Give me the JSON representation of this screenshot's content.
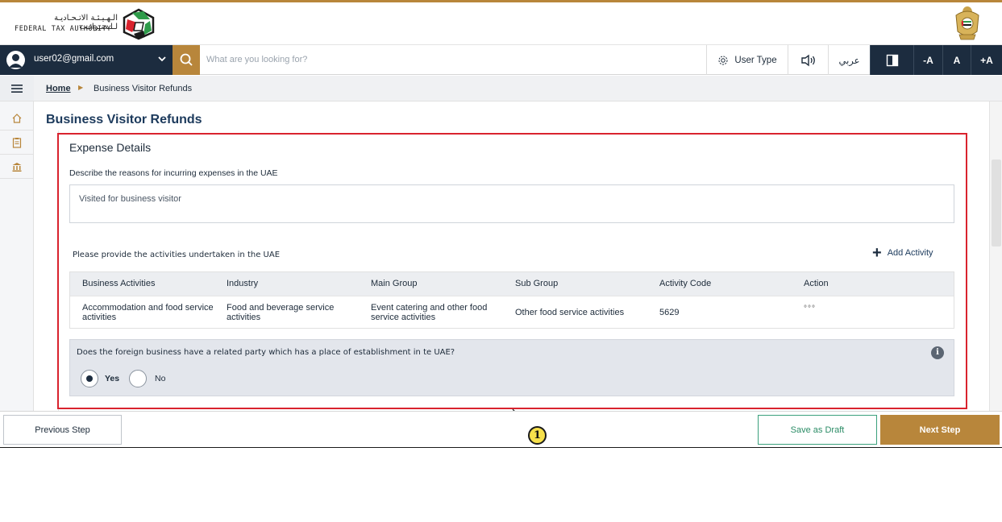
{
  "header": {
    "logo_arabic": "الـهـيـئـة الاتـحـاديـة لـلـضـرائـب",
    "logo_english": "FEDERAL TAX AUTHORITY",
    "logo_icon": "fta-logo-icon",
    "emblem_icon": "uae-emblem-icon"
  },
  "toolbar": {
    "user_email": "user02@gmail.com",
    "search_placeholder": "What are you looking for?",
    "user_type_label": "User Type",
    "arabic_label": "عربي",
    "font_decrease": "-A",
    "font_normal": "A",
    "font_increase": "+A"
  },
  "breadcrumb": {
    "home": "Home",
    "current": "Business Visitor Refunds"
  },
  "page": {
    "title": "Business Visitor Refunds"
  },
  "expense": {
    "section_title": "Expense Details",
    "reasons_label": "Describe the reasons for incurring expenses in the UAE",
    "reasons_value": "Visited for business visitor",
    "activities_label": "Please provide the activities undertaken in the UAE",
    "add_activity": "Add Activity",
    "table": {
      "headers": [
        "Business Activities",
        "Industry",
        "Main Group",
        "Sub Group",
        "Activity Code",
        "Action"
      ],
      "rows": [
        [
          "Accommodation and food service activities",
          "Food and beverage service activities",
          "Event catering and other food service activities",
          "Other food service activities",
          "5629",
          "°°°"
        ]
      ]
    },
    "question": "Does the foreign business have a related party which has a place of establishment in te UAE?",
    "answer_yes": "Yes",
    "answer_no": "No",
    "selected": "Yes"
  },
  "annotation": {
    "callout_number": "1"
  },
  "footer": {
    "previous": "Previous Step",
    "save_draft": "Save as Draft",
    "next": "Next Step"
  },
  "colors": {
    "brand_gold": "#b8863b",
    "navy": "#1c2c3f",
    "highlight_red": "#d9232e",
    "draft_green": "#3aa07c"
  }
}
